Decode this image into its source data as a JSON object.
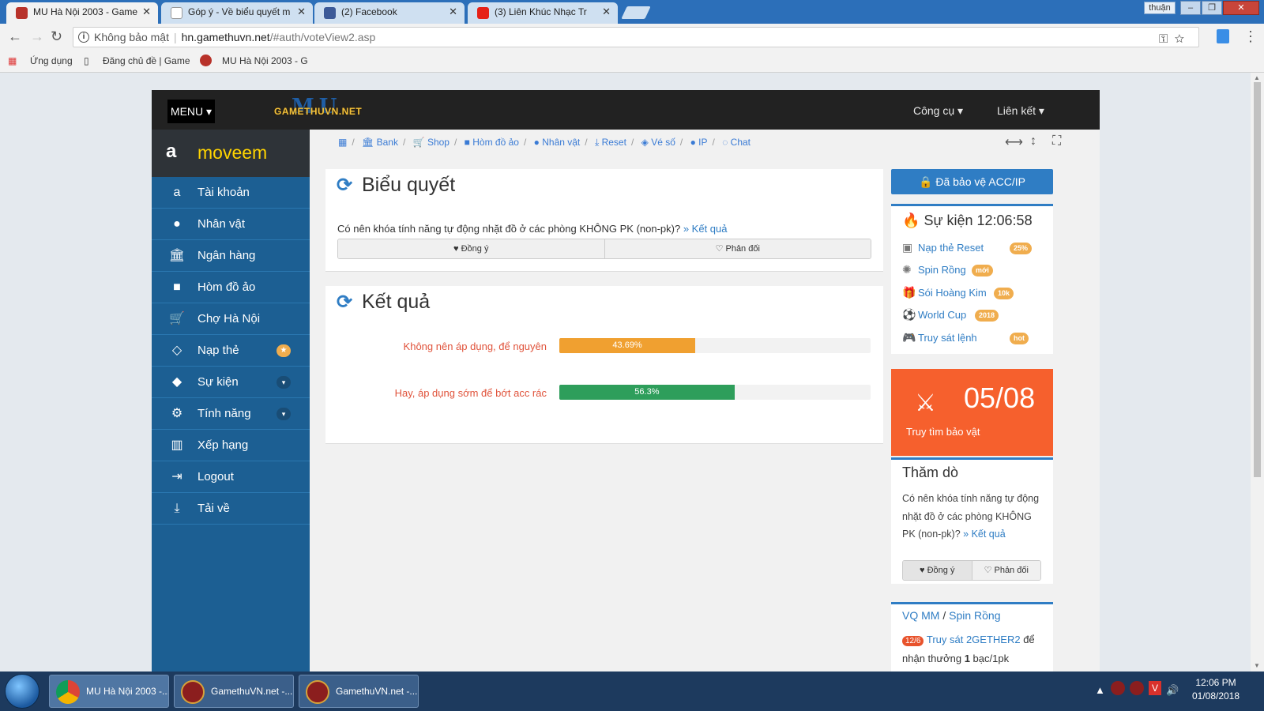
{
  "browser": {
    "tabs": [
      {
        "title": "MU Hà Nội 2003 - Game",
        "active": true
      },
      {
        "title": "Góp ý - Về biểu quyết m",
        "active": false
      },
      {
        "title": "(2) Facebook",
        "active": false
      },
      {
        "title": "(3) Liên Khúc Nhạc Tr",
        "active": false
      }
    ],
    "profile_name": "thuận",
    "address": {
      "security": "Không bảo mật",
      "domain": "hn.gamethuvn.net",
      "path": "/#auth/voteView2.asp"
    },
    "bookmarks": [
      "Ứng dụng",
      "Đăng chủ đề | Game",
      "MU Hà Nội 2003 - G"
    ]
  },
  "site": {
    "menu_label": "MENU",
    "logo_text": "GAMETHUVN.NET",
    "logo_mark": "MU",
    "top_menu": [
      "Công cụ",
      "Liên kết"
    ],
    "username": "moveem",
    "sidebar": [
      {
        "label": "Tài khoản",
        "icon": "amazon-icon"
      },
      {
        "label": "Nhân vật",
        "icon": "user-icon"
      },
      {
        "label": "Ngân hàng",
        "icon": "bank-icon"
      },
      {
        "label": "Hòm đồ ảo",
        "icon": "briefcase-icon"
      },
      {
        "label": "Chợ Hà Nội",
        "icon": "cart-icon"
      },
      {
        "label": "Nạp thẻ",
        "icon": "diamond-icon",
        "badge": "star"
      },
      {
        "label": "Sự kiện",
        "icon": "android-icon",
        "badge": "chevron"
      },
      {
        "label": "Tính năng",
        "icon": "cogs-icon",
        "badge": "chevron"
      },
      {
        "label": "Xếp hạng",
        "icon": "bar-chart-icon"
      },
      {
        "label": "Logout",
        "icon": "sign-out-icon"
      },
      {
        "label": "Tải về",
        "icon": "download-icon"
      }
    ],
    "breadcrumbs": [
      "Bank",
      "Shop",
      "Hòm đồ ảo",
      "Nhân vật",
      "Reset",
      "Vé số",
      "IP",
      "Chat"
    ],
    "vote_card": {
      "title": "Biểu quyết",
      "question": "Có nên khóa tính năng tự động nhặt đồ ở các phòng KHÔNG PK (non-pk)?",
      "result_link": "» Kết quả",
      "agree": "Đồng ý",
      "disagree": "Phản đối"
    },
    "result_card": {
      "title": "Kết quả",
      "rows": [
        {
          "label": "Không nên áp dụng, để nguyên",
          "percent_text": "43.69%",
          "value": 43.69,
          "color": "#f0a030"
        },
        {
          "label": "Hay, áp dụng sớm để bớt acc rác",
          "percent_text": "56.3%",
          "value": 56.3,
          "color": "#2e9e5b"
        }
      ]
    },
    "protect_button": "Đã bảo vệ ACC/IP",
    "events": {
      "title": "Sự kiện 12:06:58",
      "items": [
        {
          "label": "Nạp thẻ Reset",
          "badge": "25%",
          "badge_color": "#f0ad4e"
        },
        {
          "label": "Spin Rồng",
          "badge": "mới",
          "badge_color": "#f0ad4e"
        },
        {
          "label": "Sói Hoàng Kim",
          "badge": "10k",
          "badge_color": "#f0ad4e"
        },
        {
          "label": "World Cup",
          "badge": "2018",
          "badge_color": "#f0ad4e"
        },
        {
          "label": "Truy sát lệnh",
          "badge": "hot",
          "badge_color": "#f0ad4e"
        }
      ]
    },
    "treasure": {
      "date": "05/08",
      "label": "Truy tìm bảo vật"
    },
    "poll": {
      "title": "Thăm dò",
      "question": "Có nên khóa tính năng tự động nhặt đồ ở các phòng KHÔNG PK (non-pk)?",
      "result_link": "» Kết quả",
      "agree": "Đồng ý",
      "disagree": "Phản đối"
    },
    "vq": {
      "title_a": "VQ MM",
      "sep": " / ",
      "title_b": "Spin Rồng",
      "badge": "12/6",
      "link": "Truy sát 2GETHER2",
      "text_a": " để nhận thưởng ",
      "text_b": "1",
      "text_c": " bạc/1pk"
    }
  },
  "taskbar": {
    "tasks": [
      "MU Hà Nội 2003 -...",
      "GamethuVN.net -...",
      "GamethuVN.net -..."
    ],
    "time": "12:06 PM",
    "date": "01/08/2018"
  }
}
